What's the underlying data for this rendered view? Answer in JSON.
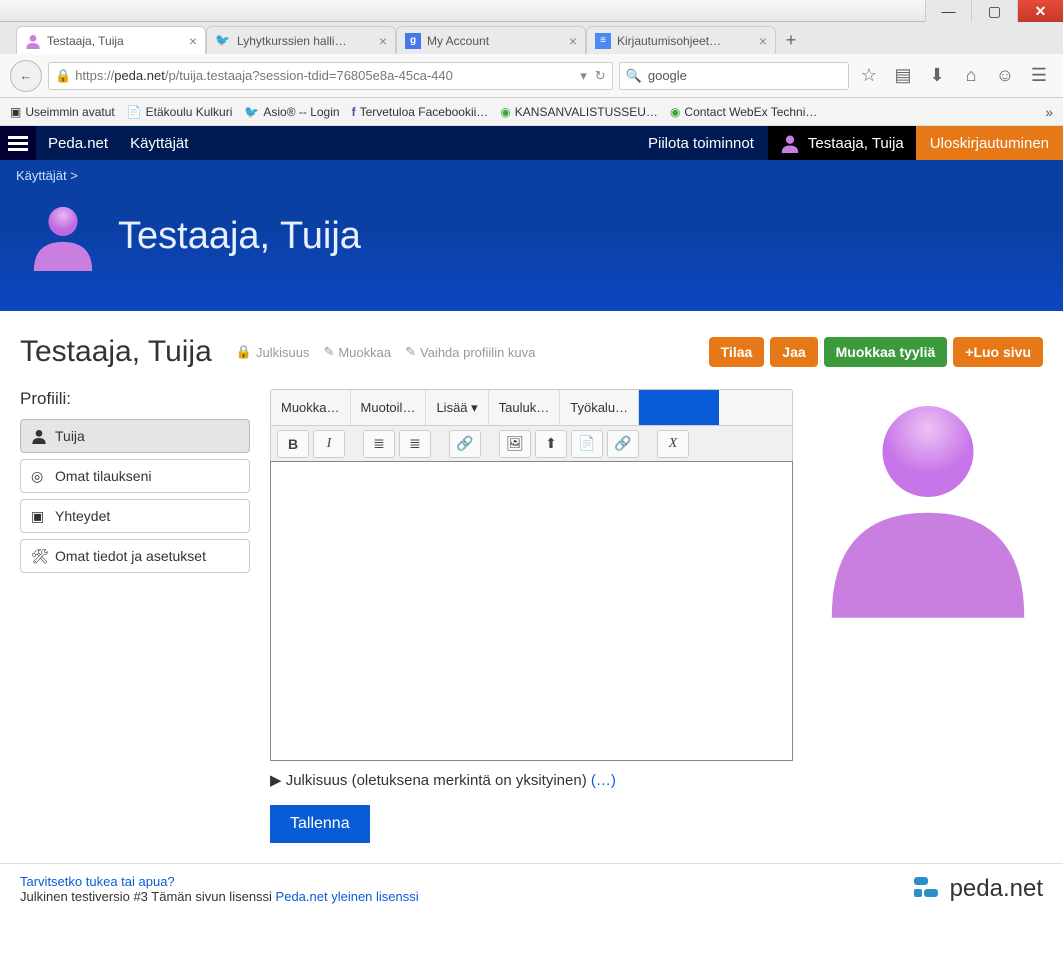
{
  "window": {
    "min": "—",
    "max": "▢",
    "close": "✕"
  },
  "tabs": {
    "items": [
      {
        "label": "Testaaja, Tuija",
        "active": true
      },
      {
        "label": "Lyhytkurssien halli…"
      },
      {
        "label": "My Account"
      },
      {
        "label": "Kirjautumisohjeet…"
      }
    ],
    "new": "+"
  },
  "nav": {
    "back": "←",
    "url_prefix": "https://",
    "url_domain": "peda.net",
    "url_rest": "/p/tuija.testaaja?session-tdid=76805e8a-45ca-440",
    "search_value": "google",
    "search_icon_name": "search-icon"
  },
  "bookmarks": {
    "items": [
      "Useimmin avatut",
      "Etäkoulu Kulkuri",
      "Asio® -- Login",
      "Tervetuloa Facebookii…",
      "KANSANVALISTUSSEU…",
      "Contact WebEx Techni…"
    ],
    "more": "»"
  },
  "topbar": {
    "brand": "Peda.net",
    "nav1": "Käyttäjät",
    "hide": "Piilota toiminnot",
    "user": "Testaaja, Tuija",
    "logout": "Uloskirjautuminen"
  },
  "hero": {
    "breadcrumb": "Käyttäjät >",
    "name": "Testaaja, Tuija"
  },
  "header2": {
    "title": "Testaaja, Tuija",
    "meta1": "Julkisuus",
    "meta2": "Muokkaa",
    "meta3": "Vaihda profiilin kuva",
    "btn_tilaa": "Tilaa",
    "btn_jaa": "Jaa",
    "btn_tyyli": "Muokkaa tyyliä",
    "btn_luo": "Luo sivu"
  },
  "sidebar": {
    "heading": "Profiili:",
    "items": [
      {
        "label": "Tuija"
      },
      {
        "label": "Omat tilaukseni"
      },
      {
        "label": "Yhteydet"
      },
      {
        "label": "Omat tiedot ja asetukset"
      }
    ]
  },
  "editor": {
    "menus": [
      "Muokka…",
      "Muotoil…",
      "Lisää ▾",
      "Tauluk…",
      "Työkalu…"
    ],
    "tools": {
      "bold": "B",
      "italic": "I",
      "ul": "≣",
      "ol": "≣",
      "link": "🔗",
      "image": "🖼",
      "upload": "⬆",
      "file": "📄",
      "anchor": "🔗",
      "clear": "X"
    },
    "disclosure_prefix": "▶",
    "disclosure_text": "Julkisuus (oletuksena merkintä on yksityinen) ",
    "disclosure_ellipsis": "(…)",
    "save": "Tallenna"
  },
  "footer": {
    "help": "Tarvitsetko tukea tai apua?",
    "license_pre": "Julkinen testiversio #3 Tämän sivun lisenssi ",
    "license_link": "Peda.net yleinen lisenssi",
    "logo_text": "peda.net"
  }
}
